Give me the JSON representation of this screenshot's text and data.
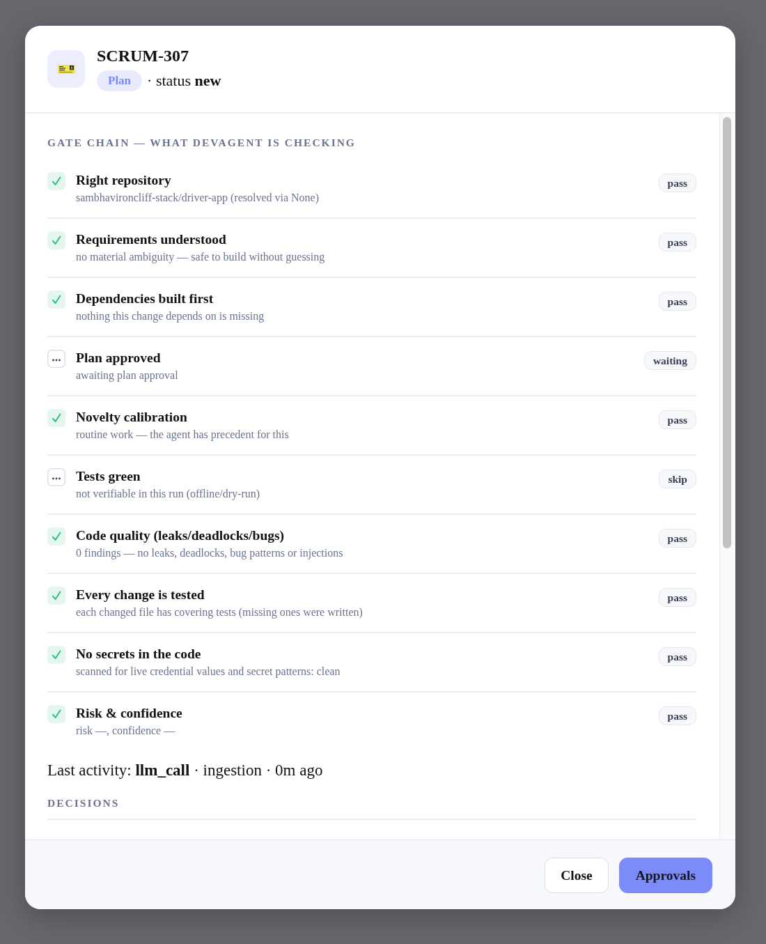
{
  "dialog": {
    "title": "SCRUM-307",
    "stage_badge": "Plan",
    "status_text": "· status **new**"
  },
  "gate_chain": {
    "heading": "GATE CHAIN — WHAT DEVAGENT IS CHECKING",
    "gates": [
      {
        "title": "Right repository",
        "detail": "sambhavironcliff-stack/driver-app (resolved via None)",
        "passed": true,
        "badge": "pass"
      },
      {
        "title": "Requirements understood",
        "detail": "no material ambiguity — safe to build without guessing",
        "passed": true,
        "badge": "pass"
      },
      {
        "title": "Dependencies built first",
        "detail": "nothing this change depends on is missing",
        "passed": true,
        "badge": "pass"
      },
      {
        "title": "Plan approved",
        "detail": "awaiting plan approval",
        "passed": false,
        "badge": "waiting"
      },
      {
        "title": "Novelty calibration",
        "detail": "routine work — the agent has precedent for this",
        "passed": true,
        "badge": "pass"
      },
      {
        "title": "Tests green",
        "detail": "not verifiable in this run (offline/dry-run)",
        "passed": false,
        "badge": "skip"
      },
      {
        "title": "Code quality (leaks/deadlocks/bugs)",
        "detail": "0 findings — no leaks, deadlocks, bug patterns or injections",
        "passed": true,
        "badge": "pass"
      },
      {
        "title": "Every change is tested",
        "detail": "each changed file has covering tests (missing ones were written)",
        "passed": true,
        "badge": "pass"
      },
      {
        "title": "No secrets in the code",
        "detail": "scanned for live credential values and secret patterns: clean",
        "passed": true,
        "badge": "pass"
      },
      {
        "title": "Risk & confidence",
        "detail": "risk —, confidence —",
        "passed": true,
        "badge": "pass"
      }
    ]
  },
  "last_activity": "Last activity: **llm_call** · ingestion · 0m ago",
  "decisions": {
    "heading": "DECISIONS"
  },
  "footer": {
    "buttons": [
      {
        "label": "Close",
        "kind": "secondary"
      },
      {
        "label": "Approvals",
        "kind": "primary"
      }
    ]
  }
}
